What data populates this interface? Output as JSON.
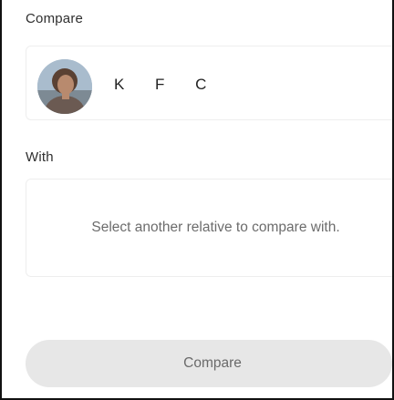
{
  "compare_section": {
    "heading": "Compare",
    "person": {
      "name": "K F C",
      "avatar_icon": "person-photo-avatar"
    }
  },
  "with_section": {
    "heading": "With",
    "placeholder_text": "Select another relative to compare with."
  },
  "actions": {
    "compare_button_label": "Compare"
  },
  "colors": {
    "heading_text": "#2f2f2f",
    "placeholder_text": "#6c6c6c",
    "button_background": "#e7e7e7",
    "button_text": "#6a6a6a",
    "card_border": "#eeeeee"
  }
}
